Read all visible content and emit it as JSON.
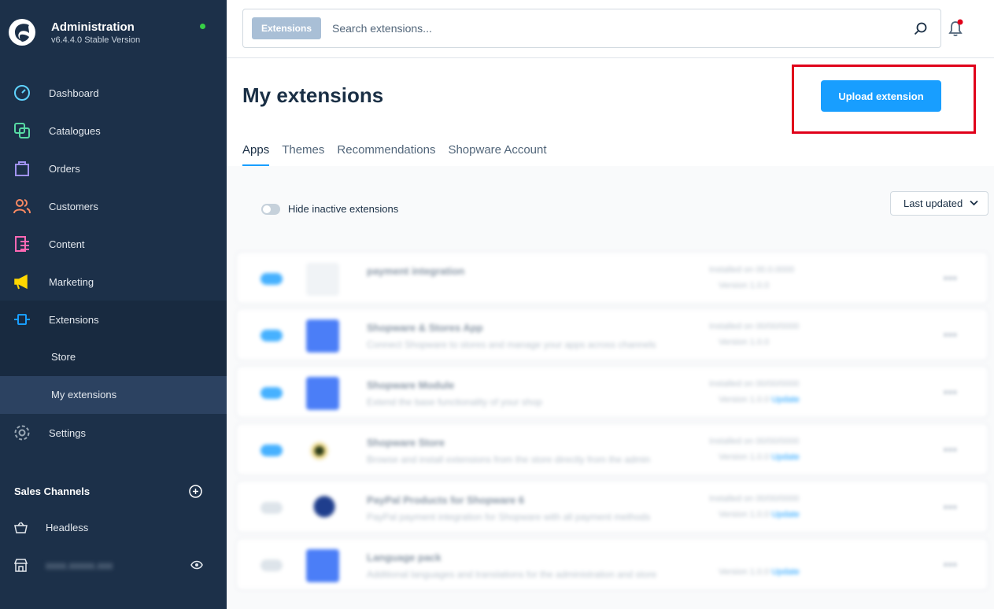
{
  "brand": {
    "title": "Administration",
    "version": "v6.4.4.0 Stable Version",
    "status_color": "#37d046"
  },
  "sidebar": {
    "items": [
      {
        "label": "Dashboard",
        "icon": "dashboard-icon",
        "color": "#5fd3ff"
      },
      {
        "label": "Catalogues",
        "icon": "catalogues-icon",
        "color": "#57d9a3"
      },
      {
        "label": "Orders",
        "icon": "orders-icon",
        "color": "#a092f0"
      },
      {
        "label": "Customers",
        "icon": "customers-icon",
        "color": "#f88962"
      },
      {
        "label": "Content",
        "icon": "content-icon",
        "color": "#ff68b4"
      },
      {
        "label": "Marketing",
        "icon": "marketing-icon",
        "color": "#ffd700"
      },
      {
        "label": "Extensions",
        "icon": "extensions-icon",
        "color": "#189eff"
      },
      {
        "label": "Settings",
        "icon": "settings-icon",
        "color": "#9aa8b5"
      }
    ],
    "sub_items": [
      {
        "label": "Store"
      },
      {
        "label": "My extensions"
      }
    ],
    "sales_channels": {
      "title": "Sales Channels",
      "items": [
        {
          "label": "Headless",
          "icon": "basket-icon"
        },
        {
          "label": "xxxx.xxxxx.xxx",
          "icon": "storefront-icon"
        }
      ]
    }
  },
  "topbar": {
    "search_badge": "Extensions",
    "search_placeholder": "Search extensions..."
  },
  "main": {
    "title": "My extensions",
    "upload_label": "Upload extension",
    "tabs": [
      {
        "label": "Apps",
        "active": true
      },
      {
        "label": "Themes"
      },
      {
        "label": "Recommendations"
      },
      {
        "label": "Shopware Account"
      }
    ],
    "hide_inactive_label": "Hide inactive extensions",
    "hide_inactive_on": false,
    "sort_label": "Last updated"
  },
  "extensions": [
    {
      "name": "payment integration",
      "desc": "",
      "meta1": "Installed on 00.0.0000",
      "meta2": "Version 1.0.0",
      "link": "",
      "active": true,
      "thumb": "empty"
    },
    {
      "name": "Shopware & Stores App",
      "desc": "Connect Shopware to stores and manage your apps across channels",
      "meta1": "Installed on 00/00/0000",
      "meta2": "Version 1.0.0",
      "link": "",
      "active": true,
      "thumb": "blue"
    },
    {
      "name": "Shopware Module",
      "desc": "Extend the base functionality of your shop",
      "meta1": "Installed on 00/00/0000",
      "meta2": "Version 1.0.0",
      "link": "Update",
      "active": true,
      "thumb": "blue"
    },
    {
      "name": "Shopware Store",
      "desc": "Browse and install extensions from the store directly from the admin",
      "meta1": "Installed on 00/00/0000",
      "meta2": "Version 1.0.0",
      "link": "Update",
      "active": true,
      "thumb": "shop"
    },
    {
      "name": "PayPal Products for Shopware 6",
      "desc": "PayPal payment integration for Shopware with all payment methods",
      "meta1": "Installed on 00/00/0000",
      "meta2": "Version 1.0.0",
      "link": "Update",
      "active": false,
      "thumb": "paypal"
    },
    {
      "name": "Language pack",
      "desc": "Additional languages and translations for the administration and store",
      "meta1": "",
      "meta2": "Version 1.0.0",
      "link": "Update",
      "active": false,
      "thumb": "blue"
    }
  ]
}
